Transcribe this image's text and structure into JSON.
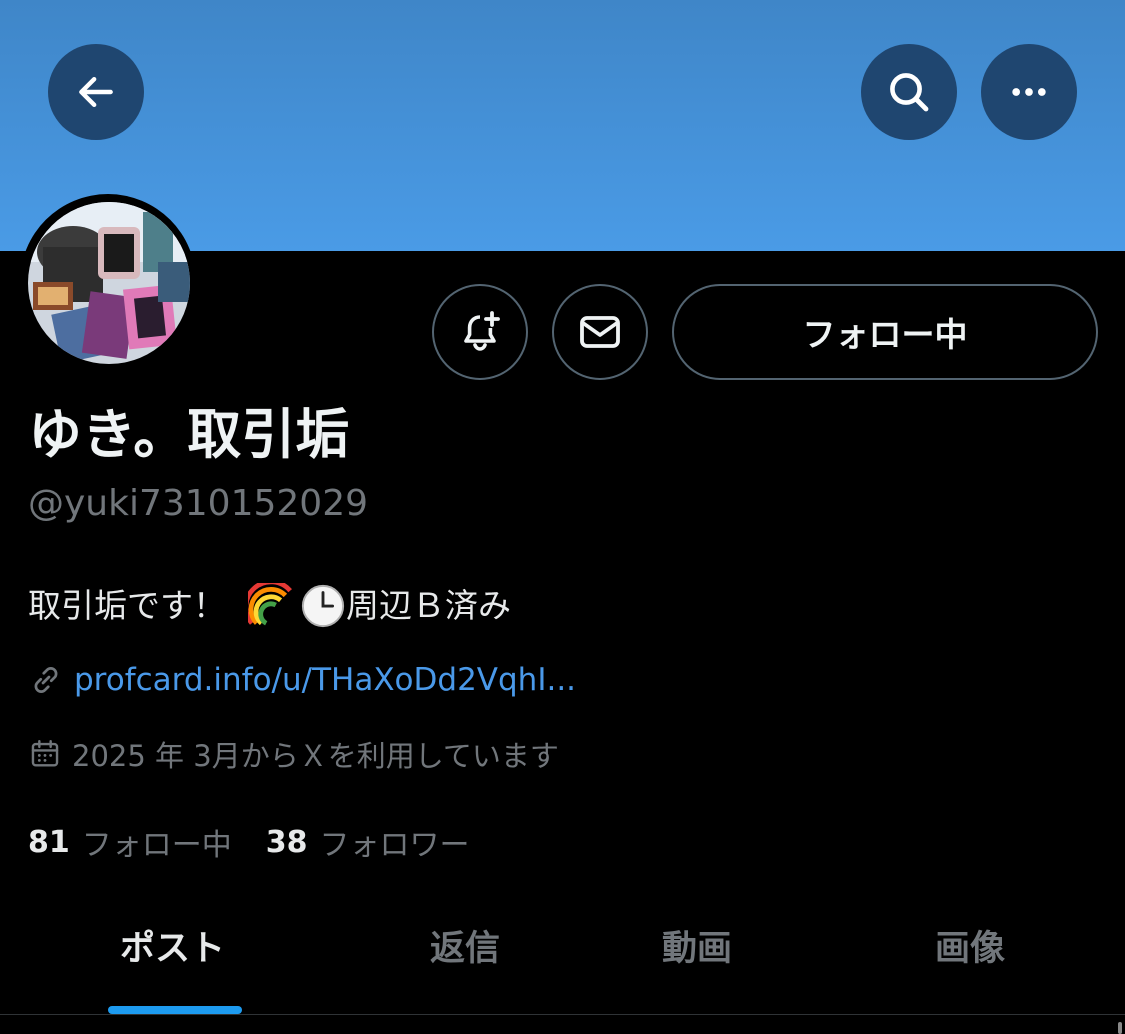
{
  "profile": {
    "display_name": "ゆき。取引垢",
    "handle": "@yuki7310152029",
    "bio_text": "取引垢です！",
    "bio_suffix": "周辺Ｂ済み",
    "link": "profcard.info/u/THaXoDd2VqhI...",
    "joined": "2025 年 3月からＸを利用しています"
  },
  "actions": {
    "follow_label": "フォロー中"
  },
  "stats": {
    "following_count": "81",
    "following_label": "フォロー中",
    "followers_count": "38",
    "followers_label": "フォロワー"
  },
  "tabs": [
    {
      "label": "ポスト",
      "active": true
    },
    {
      "label": "返信",
      "active": false
    },
    {
      "label": "動画",
      "active": false
    },
    {
      "label": "画像",
      "active": false
    }
  ],
  "icons": {
    "back": "arrow-left-icon",
    "search": "search-icon",
    "more": "more-dots-icon",
    "notify": "bell-plus-icon",
    "dm": "envelope-icon",
    "link": "link-icon",
    "calendar": "calendar-icon",
    "bio_emoji_1": "rainbow-emoji",
    "bio_emoji_2": "clock-emoji"
  },
  "colors": {
    "banner": "#4a9be6",
    "link": "#4a99e9",
    "muted": "#71767b",
    "accent": "#1d9bf0"
  }
}
